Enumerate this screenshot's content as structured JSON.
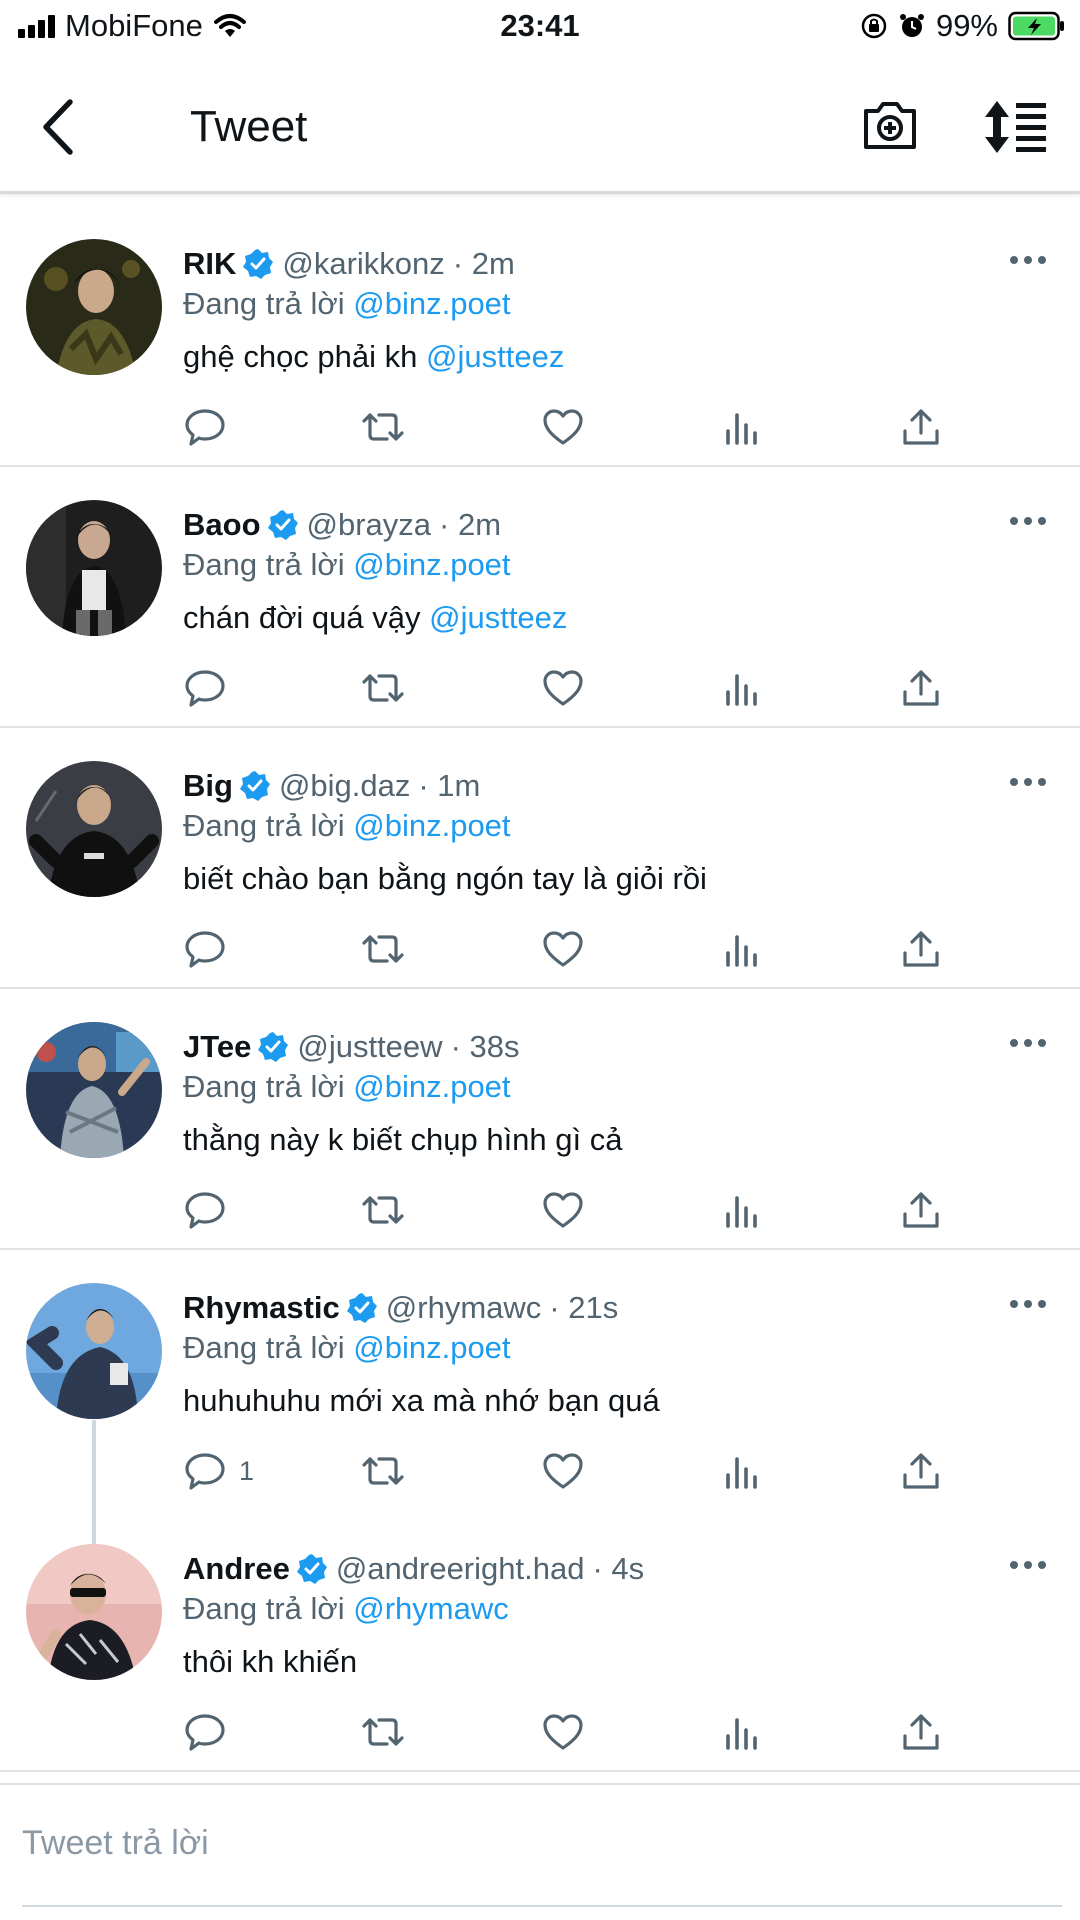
{
  "status_bar": {
    "carrier": "MobiFone",
    "time": "23:41",
    "battery": "99%"
  },
  "header": {
    "title": "Tweet"
  },
  "tweets": [
    {
      "name": "RIK",
      "handle": "@karikkonz",
      "time": "· 2m",
      "reply_prefix": "Đang trả lời",
      "reply_to": "@binz.poet",
      "text": "ghệ chọc phải kh",
      "text_mention": "@justteez",
      "reply_count": ""
    },
    {
      "name": "Baoo",
      "handle": "@brayza",
      "time": "· 2m",
      "reply_prefix": "Đang trả lời",
      "reply_to": "@binz.poet",
      "text": "chán đời quá vậy",
      "text_mention": "@justteez",
      "reply_count": ""
    },
    {
      "name": "Big",
      "handle": "@big.daz",
      "time": "· 1m",
      "reply_prefix": "Đang trả lời",
      "reply_to": "@binz.poet",
      "text": "biết chào bạn bằng ngón tay là giỏi rồi",
      "text_mention": "",
      "reply_count": ""
    },
    {
      "name": "JTee",
      "handle": "@justteew",
      "time": "· 38s",
      "reply_prefix": "Đang trả lời",
      "reply_to": "@binz.poet",
      "text": "thằng này k biết chụp hình gì cả",
      "text_mention": "",
      "reply_count": ""
    },
    {
      "name": "Rhymastic",
      "handle": "@rhymawc",
      "time": "· 21s",
      "reply_prefix": "Đang trả lời",
      "reply_to": "@binz.poet",
      "text": "huhuhuhu mới xa mà nhớ bạn quá",
      "text_mention": "",
      "reply_count": "1"
    },
    {
      "name": "Andree",
      "handle": "@andreeright.had",
      "time": "· 4s",
      "reply_prefix": "Đang trả lời",
      "reply_to": "@rhymawc",
      "text": "thôi kh khiến",
      "text_mention": "",
      "reply_count": ""
    }
  ],
  "composer": {
    "placeholder": "Tweet trả lời"
  },
  "colors": {
    "accent": "#1d9bf0",
    "secondary_text": "#536471"
  },
  "icons": [
    "signal-icon",
    "wifi-icon",
    "lock-rotation-icon",
    "alarm-icon",
    "battery-charging-icon",
    "back-arrow-icon",
    "camera-plus-icon",
    "sort-icon",
    "verified-badge-icon",
    "more-icon",
    "reply-icon",
    "retweet-icon",
    "like-icon",
    "analytics-icon",
    "share-icon"
  ]
}
